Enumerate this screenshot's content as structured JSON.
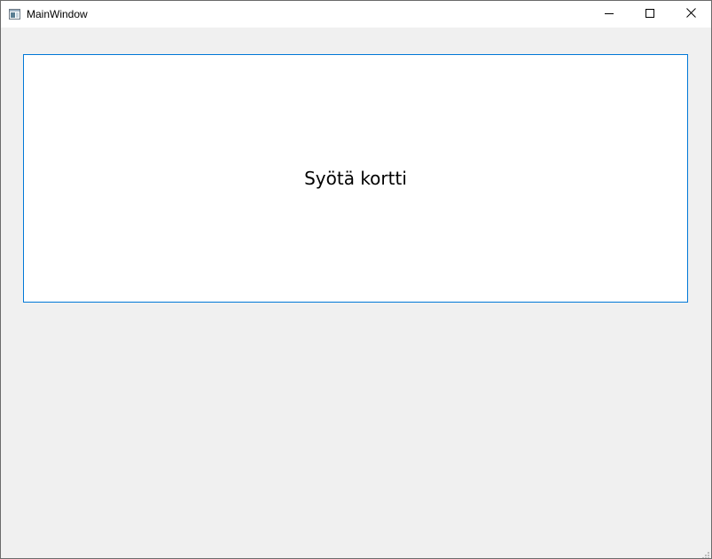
{
  "window": {
    "title": "MainWindow",
    "icon": "window-app-icon",
    "controls": {
      "minimize_icon": "minimize-icon",
      "maximize_icon": "maximize-icon",
      "close_icon": "close-icon"
    }
  },
  "main": {
    "prompt_text": "Syötä kortti"
  },
  "colors": {
    "panel_border": "#0078d7",
    "client_background": "#f0f0f0",
    "panel_background": "#ffffff"
  }
}
